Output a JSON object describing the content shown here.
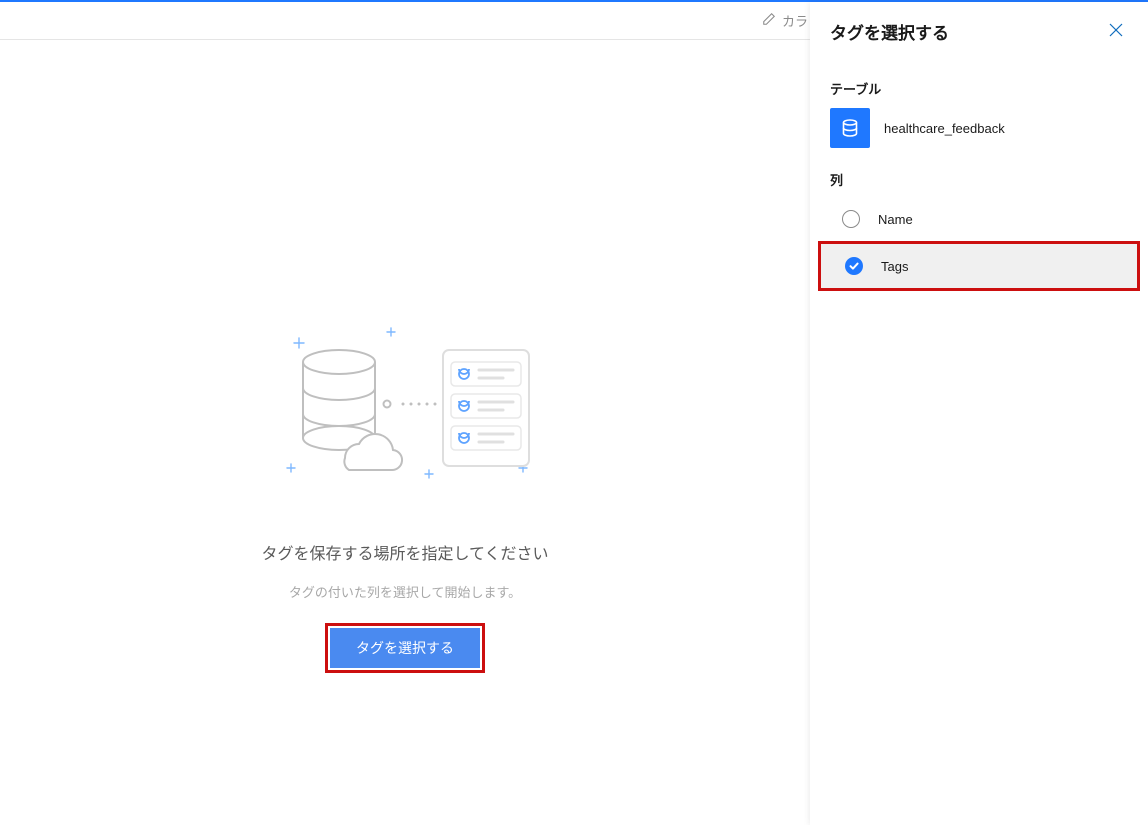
{
  "header": {
    "edit_link_label": "カラ"
  },
  "empty_state": {
    "title": "タグを保存する場所を指定してください",
    "subtitle": "タグの付いた列を選択して開始します。",
    "button_label": "タグを選択する"
  },
  "panel": {
    "title": "タグを選択する",
    "sections": {
      "table_label": "テーブル",
      "column_label": "列"
    },
    "table": {
      "name": "healthcare_feedback"
    },
    "columns": [
      {
        "name": "Name",
        "selected": false
      },
      {
        "name": "Tags",
        "selected": true
      }
    ]
  }
}
